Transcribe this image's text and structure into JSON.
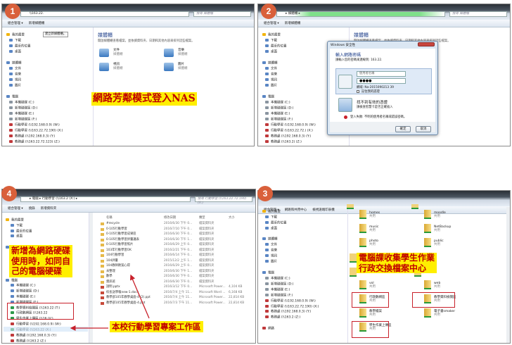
{
  "colors": {
    "badge": "#d9603b",
    "highlight": "#ffef00",
    "label_text": "#c00000",
    "box": "#c8202a"
  },
  "panel1": {
    "badge": "1",
    "address": "\\\\163.22.",
    "search_placeholder": "搜尋 媒體櫃",
    "toolbar": [
      "組合管理 ▾",
      "新增媒體櫃"
    ],
    "tooltip": "建立新媒體櫃。",
    "nav": [
      "我的最愛",
      "下載",
      "最近的位置",
      "桌面",
      "媒體櫃",
      "文件",
      "音樂",
      "視訊",
      "圖片",
      "電腦",
      "本機磁碟 (C:)",
      "新增磁碟區 (D:)",
      "本機磁碟 (E:)",
      "新增磁碟區 (F:)",
      "行動學習 (\\\\192.168.0.9) (W:)",
      "行動學習 (\\\\163.22.72.190) (X:)",
      "教務處 (\\\\192.168.0.3) (Y:)",
      "教務處 (\\\\163.22.72.123) (Z:)"
    ],
    "content_title": "媒體櫃",
    "content_sub": "開啟媒體櫃查看檔案，並依據資料夾、日期和其他內容來排列這些檔案。",
    "libs": [
      {
        "name": "文件",
        "type": "媒體櫃"
      },
      {
        "name": "音樂",
        "type": "媒體櫃"
      },
      {
        "name": "視訊",
        "type": "媒體櫃"
      },
      {
        "name": "圖片",
        "type": "媒體櫃"
      }
    ],
    "label": "網路芳鄰模式登入NAS"
  },
  "panel2": {
    "badge": "2",
    "address": "▸ 媒體櫃 ▸",
    "search_placeholder": "搜尋 媒體櫃",
    "toolbar": [
      "組合管理 ▾",
      "新增媒體櫃"
    ],
    "nav": [
      "我的最愛",
      "下載",
      "最近的位置",
      "桌面",
      "媒體櫃",
      "文件",
      "音樂",
      "視訊",
      "圖片",
      "電腦",
      "本機磁碟 (C:)",
      "新增磁碟區 (D:)",
      "本機磁碟 (E:)",
      "新增磁碟區 (F:)",
      "行動學習 (\\\\192.168.0.9) (W:)",
      "行動學習 (\\\\163.22.72.) (X:)",
      "教務處 (\\\\192.168.0.3) (Y:)",
      "教務處 (\\\\163.2) (Z:)"
    ],
    "content_title": "媒體櫃",
    "content_sub": "開啟媒體櫃查看檔案，並依據資料夾、日期和其他內容來排列這些檔案。",
    "dialog": {
      "title": "Windows 安全性",
      "heading": "輸入網路密碼",
      "desc": "請輸入您的密碼來連線到: 163.22.",
      "username_placeholder": "使用者名稱",
      "password_value": "●●●●",
      "domain": "網域: Na-2015090213 39",
      "remember": "記住我的認證",
      "cert_title": "找不到有效的憑證",
      "cert_desc": "請檢查智慧卡是否正確插入",
      "error": "登入失敗: 不明的使用者名稱或錯誤密碼。",
      "ok": "確定",
      "cancel": "取消"
    }
  },
  "panel4": {
    "badge": "4",
    "address": "▸ 電腦 ▸ 行動學習 (\\\\163.2 (X:) ▸",
    "search_placeholder": "搜尋 行動學習 (\\\\163.22.72.190) (X:)",
    "toolbar": [
      "組合管理 ▾",
      "燒錄",
      "新增資料夾"
    ],
    "nav": [
      "我的最愛",
      "下載",
      "最近的位置",
      "桌面",
      "媒體櫃",
      "電腦",
      "本機磁碟 (C:)",
      "新增磁碟區 (D:)",
      "本機磁碟 (E:)",
      "新增磁碟區 (F:)",
      "教學資料檢閱區 (\\\\163.22 (T:)",
      "行政數網區 (\\\\163.22",
      "學生作業上傳區 (\\\\16 (V:)",
      "行動學習 (\\\\192.168.0.9) (W:)",
      "行動學習 (\\\\163.22 (X:)",
      "教務處 (\\\\192.168.0.3) (Y:)",
      "教務處 (\\\\163.2 (Z:)"
    ],
    "columns": [
      "名稱",
      "修改日期",
      "類型",
      "大小"
    ],
    "files": [
      [
        "#recycle",
        "2016/6/30 下午 0...",
        "檔案資料夾",
        ""
      ],
      [
        "0-105行動學習",
        "2016/7/10 下午 0...",
        "檔案資料夾",
        ""
      ],
      [
        "0-105行動學習成果區",
        "2016/6/30 下午 0...",
        "檔案資料夾",
        ""
      ],
      [
        "0-105行動學習評量議表",
        "2016/6/30 下午 1...",
        "檔案資料夾",
        ""
      ],
      [
        "0-105行動學習照片",
        "2016/6/29 上午 0...",
        "檔案資料夾",
        ""
      ],
      [
        "103年行動學習OK",
        "2016/2/21 下午 0...",
        "檔案資料夾",
        ""
      ],
      [
        "104行動學習",
        "2016/6/14 下午 0...",
        "檔案資料夾",
        ""
      ],
      [
        "104評量",
        "2015/12/2 上午 1...",
        "檔案資料夾",
        ""
      ],
      [
        "104教師教案心得",
        "2016/6/29 上午 0...",
        "檔案資料夾",
        ""
      ],
      [
        "未整理",
        "2016/6/30 下午 1...",
        "檔案資料夾",
        ""
      ],
      [
        "數學",
        "2016/6/30 下午 0...",
        "檔案資料夾",
        ""
      ],
      [
        "資訊班",
        "2016/6/30 下午 0...",
        "檔案資料夾",
        ""
      ],
      [
        "說明.pptx",
        "2016/3/12 下午 0...",
        "Microsoft Power...",
        "4,104 KB"
      ],
      [
        "校長送學報new-1.docx",
        "2016/7/4 上午 11...",
        "Microsoft Word ...",
        "6,168 KB"
      ],
      [
        "教學部105年教學桌面-4 (2).ppt",
        "2016/7/4 上午 11...",
        "Microsoft Power...",
        "22,814 KB"
      ],
      [
        "教學部105年教學桌面-4.ppt",
        "2016/7/3 下午 11...",
        "Microsoft Power...",
        "22,814 KB"
      ]
    ],
    "label1": [
      "新增為網路硬碟",
      "使用時，如同自",
      "己的電腦硬碟"
    ],
    "label2": "本校行動學習專案工作區"
  },
  "panel3": {
    "badge": "3",
    "toolbar": [
      "組合管理 ▾",
      "網路和共用中心",
      "檢視遠端印表機"
    ],
    "nav": [
      "我的最愛",
      "下載",
      "最近的位置",
      "桌面",
      "媒體櫃",
      "文件",
      "音樂",
      "視訊",
      "圖片",
      "電腦",
      "本機磁碟 (C:)",
      "新增磁碟區 (D:)",
      "本機磁碟 (E:)",
      "新增磁碟區 (F:)",
      "行動學習 (\\\\192.168.0.9) (W:)",
      "行動學習 (\\\\163.22.72.190) (X:)",
      "教務處 (\\\\192.168.0.3) (Y:)",
      "教務處 (\\\\163.2 (Z:)",
      "網路"
    ],
    "shares": [
      {
        "name": "homes",
        "type": "共用"
      },
      {
        "name": "moodle",
        "type": "共用"
      },
      {
        "name": "music",
        "type": "共用"
      },
      {
        "name": "NetBackup",
        "type": "共用"
      },
      {
        "name": "photo",
        "type": "共用"
      },
      {
        "name": "public",
        "type": "共用"
      },
      {
        "name": "vol",
        "type": "共用"
      },
      {
        "name": "web",
        "type": "共用"
      },
      {
        "name": "行政數網區",
        "type": "共用"
      },
      {
        "name": "教學資料檢閱區",
        "type": "共用"
      },
      {
        "name": "教學檔案",
        "type": "共用"
      },
      {
        "name": "電子書smaker",
        "type": "共用"
      },
      {
        "name": "學生作業上傳區",
        "type": "共用"
      }
    ],
    "label": [
      "電腦課收集學生作業",
      "行政交換檔案中心"
    ]
  }
}
